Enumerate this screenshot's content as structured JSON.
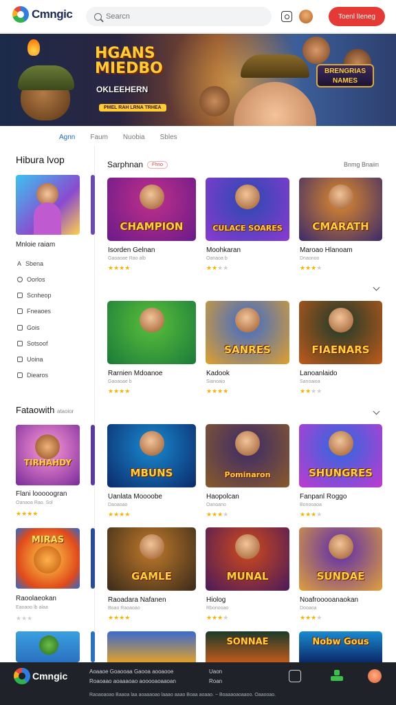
{
  "header": {
    "logo": "Cmngic",
    "search_placeholder": "Searcn",
    "cta_label": "Toenl lIeneg"
  },
  "banner": {
    "title": "HGANS MIEDBO",
    "subtitle": "OKLEEHERN",
    "pill": "PMEL RAH LRNA TRHEA",
    "badge": "BRENGRIAS NAMES"
  },
  "tabs": [
    "Agnn",
    "Faum",
    "Nuobia",
    "Sbles"
  ],
  "sidebar": {
    "title": "Hibura lvop",
    "caption": "Mnloie raiam",
    "menu": [
      "Sbena",
      "Oorlos",
      "Scnheop",
      "Fneaoes",
      "Gois",
      "Sotsoof",
      "Uoina",
      "Diearos"
    ],
    "section2_title": "Fataowith",
    "section2_note": "ataoior",
    "cards": [
      {
        "name": "Flani looooogran",
        "sub": "Oanaoa Rao. Sol",
        "rating": 4
      },
      {
        "name": "Raoolaeokan",
        "sub": "Eaoaoo lb alaa",
        "rating": 0
      }
    ]
  },
  "main": {
    "section_title": "Sarphnan",
    "section_pill": "Fhno",
    "see_all": "Bnmg Bnaiin",
    "rows": [
      [
        {
          "name": "Isorden Gelnan",
          "sub": "Gaoaoae Rao alb",
          "rating": 4,
          "art": "CHAMPION"
        },
        {
          "name": "Moohkaran",
          "sub": "Oanaoa b",
          "rating": 2,
          "art": "CULACE SOARES"
        },
        {
          "name": "Maroao Hlanoam",
          "sub": "Dnaonoo",
          "rating": 3,
          "art": "CMARATH"
        }
      ],
      [
        {
          "name": "Rarnien Mdoanoe",
          "sub": "Gaoaoae b",
          "rating": 4,
          "art": ""
        },
        {
          "name": "Kadook",
          "sub": "Sianoaio",
          "rating": 4,
          "art": "SANRES"
        },
        {
          "name": "Lanoanlaido",
          "sub": "Sanoaioa",
          "rating": 2,
          "art": "FIAENARS"
        }
      ],
      [
        {
          "name": "Uanlata Moooobe",
          "sub": "Daoaoao",
          "rating": 4,
          "art": "MBUNS"
        },
        {
          "name": "Haopolcan",
          "sub": "Oanoano",
          "rating": 3,
          "art": "Pominaron"
        },
        {
          "name": "Fanpanl Roggo",
          "sub": "Bonooaoa",
          "rating": 3,
          "art": "SHUNGRES"
        }
      ],
      [
        {
          "name": "Raoadara Nafanen",
          "sub": "Boao Raoaoao",
          "rating": 4,
          "art": "GAMLE"
        },
        {
          "name": "Hiolog",
          "sub": "Rbonooao",
          "rating": 3,
          "art": "MUNAL"
        },
        {
          "name": "Noafrooooanaokan",
          "sub": "Dooaoa",
          "rating": 3,
          "art": "SUNDAE"
        }
      ]
    ],
    "partial_row": [
      "",
      "SONNAE",
      "Nobw Gous"
    ]
  },
  "footer": {
    "logo": "Cmngic",
    "col1_line1": "Aoaaoe  Goaooaa Gaooa aooaooe",
    "col1_line2": "Roaoaao aoaaaoao aooooaoaaoan",
    "col2_line1": "Uaon",
    "col2_line2": "Roan",
    "bottom_line": "Raoaoaoao Baaoa laa aoaaaoao laaao aaao Boaa aoaao.   ~  Boaaaoaoaaoo. Oaaooao."
  },
  "colors": {
    "accent": "#e53935",
    "link": "#1a66c9",
    "star": "#f5b400",
    "footer_bg": "#1f2329"
  }
}
